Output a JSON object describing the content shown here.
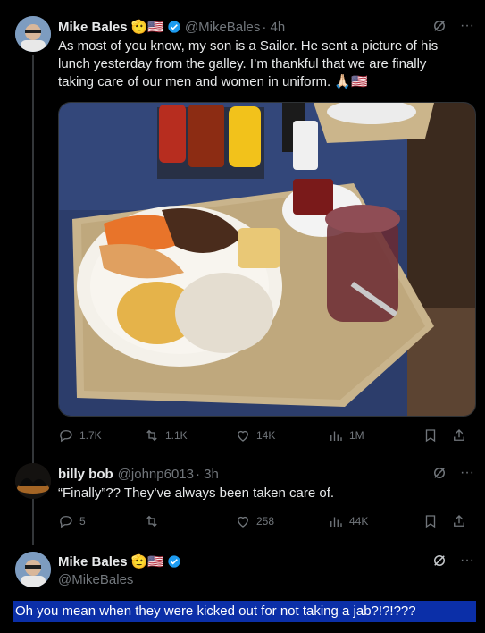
{
  "tweet1": {
    "name": "Mike Bales",
    "handle": "@MikeBales",
    "time": "· 4h",
    "text_lines": [
      "As most of you know, my son is a Sailor. He sent a picture of his",
      "lunch yesterday from the galley. I’m thankful that we are finally",
      "taking care of our men and women in uniform."
    ],
    "emoji_name": "🫡🇺🇸",
    "text_emoji": "🙏🏻🇺🇸",
    "stats": {
      "replies": "1.7K",
      "retweets": "1.1K",
      "likes": "14K",
      "views": "1M"
    }
  },
  "tweet2": {
    "name": "billy bob",
    "handle": "@johnp6013",
    "time": "· 3h",
    "text": "“Finally”??  They’ve always been taken care of.",
    "stats": {
      "replies": "5",
      "retweets": "",
      "likes": "258",
      "views": "44K"
    }
  },
  "tweet3": {
    "name": "Mike Bales",
    "emoji_name": "🫡🇺🇸",
    "handle": "@MikeBales",
    "text": "Oh you mean when they were kicked out for not taking a jab?!?!???"
  },
  "colors": {
    "background": "#000000",
    "text": "#e7e9ea",
    "muted": "#71767b",
    "verified": "#1d9bf0",
    "highlight": "#0b2fa8"
  },
  "icons": [
    "grok-icon",
    "more-icon",
    "reply-icon",
    "retweet-icon",
    "like-icon",
    "views-icon",
    "bookmark-icon",
    "share-icon",
    "verified-badge-icon"
  ]
}
